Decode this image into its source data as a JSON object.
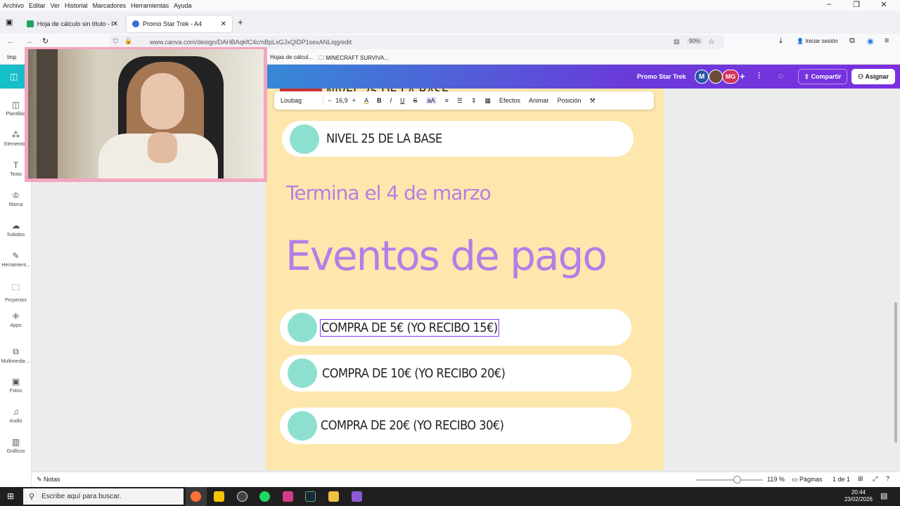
{
  "browser": {
    "menu": [
      "Archivo",
      "Editar",
      "Ver",
      "Historial",
      "Marcadores",
      "Herramientas",
      "Ayuda"
    ],
    "tabs": [
      {
        "label": "Hoja de cálculo sin título - Hoja",
        "icon": "sheets-icon"
      },
      {
        "label": "Promo Star Trek - A4",
        "icon": "canva-icon"
      }
    ],
    "url": "www.canva.com/design/DAHBAqkfC4c/nBpLxGJxQIDP1sexANLiqg/edit",
    "zoom": "90%",
    "signin": "Iniciar sesión",
    "bookmarks": [
      "Imp",
      "Hojas de cálcul...",
      "MINECRAFT SURVIVA..."
    ]
  },
  "canva_header": {
    "doc_title": "Promo Star Trek",
    "avatars": [
      "M",
      "",
      "MG"
    ],
    "share_label": "Compartir",
    "assign_label": "Asignar"
  },
  "sidebar": {
    "items": [
      {
        "label": "Plantillas",
        "icon": "templates-icon"
      },
      {
        "label": "Elementos",
        "icon": "elements-icon"
      },
      {
        "label": "Texto",
        "icon": "text-icon"
      },
      {
        "label": "Marca",
        "icon": "brand-icon"
      },
      {
        "label": "Subidos",
        "icon": "uploads-icon"
      },
      {
        "label": "Herramient...",
        "icon": "tools-icon"
      },
      {
        "label": "Proyectos",
        "icon": "projects-icon"
      },
      {
        "label": "Apps",
        "icon": "apps-icon"
      },
      {
        "label": "Multimedia ...",
        "icon": "media-icon"
      },
      {
        "label": "Fotos",
        "icon": "photos-icon"
      },
      {
        "label": "Audio",
        "icon": "audio-icon"
      },
      {
        "label": "Gráficos",
        "icon": "charts-icon"
      }
    ]
  },
  "toolbar": {
    "font": "Loubag",
    "size": "16,9",
    "effects": "Efectos",
    "animate": "Animar",
    "position": "Posición"
  },
  "design": {
    "top_item": "NIVEL 25  DE LA BASE",
    "partial_item": "NIVEL 25 DE LA BASE",
    "ends": "Termina el 4 de marzo",
    "title": "Eventos de pago",
    "items": [
      "COMPRA DE 5€ (YO RECIBO 15€)",
      "COMPRA DE 10€ (YO RECIBO 20€)",
      "COMPRA DE 20€ (YO RECIBO 30€)"
    ],
    "colors": {
      "page": "#fde7ad",
      "accent": "#b37fe6",
      "dot": "#8de0cf"
    }
  },
  "bottombar": {
    "notes": "Notas",
    "zoom": "119 %",
    "pages_label": "Páginas",
    "page_count": "1 de 1"
  },
  "taskbar": {
    "search_placeholder": "Escribe aquí para buscar.",
    "time": "20:44",
    "date": "23/02/2026"
  }
}
